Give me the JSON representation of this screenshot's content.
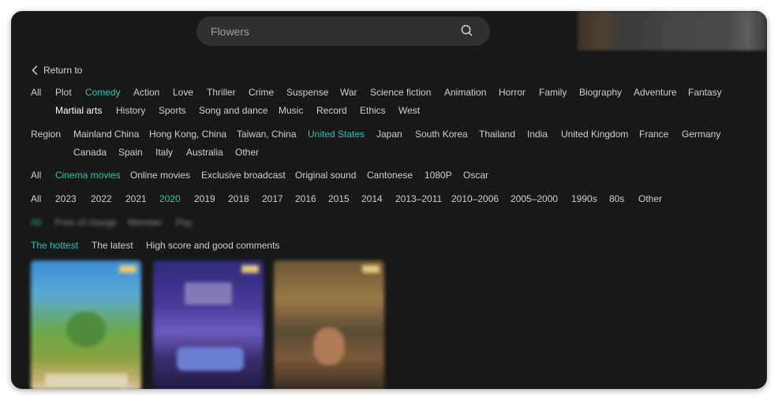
{
  "search": {
    "placeholder": "Flowers"
  },
  "nav": {
    "back_label": "Return to"
  },
  "genre": {
    "items": [
      "All",
      "Plot",
      "Comedy",
      "Action",
      "Love",
      "Thriller",
      "Crime",
      "Suspense",
      "War",
      "Science fiction",
      "Animation",
      "Horror",
      "Family",
      "Biography",
      "Adventure",
      "Fantasy",
      "Martial arts",
      "History",
      "Sports",
      "Song and dance",
      "Music",
      "Record",
      "Ethics",
      "West"
    ],
    "active": "Comedy"
  },
  "region": {
    "label": "Region",
    "items": [
      "Mainland China",
      "Hong Kong, China",
      "Taiwan, China",
      "United States",
      "Japan",
      "South Korea",
      "Thailand",
      "India",
      "United Kingdom",
      "France",
      "Germany",
      "Canada",
      "Spain",
      "Italy",
      "Australia",
      "Other"
    ],
    "active": "United States"
  },
  "feature": {
    "items": [
      "All",
      "Cinema movies",
      "Online movies",
      "Exclusive broadcast",
      "Original sound",
      "Cantonese",
      "1080P",
      "Oscar"
    ],
    "active": "Cinema movies"
  },
  "year": {
    "items": [
      "All",
      "2023",
      "2022",
      "2021",
      "2020",
      "2019",
      "2018",
      "2017",
      "2016",
      "2015",
      "2014",
      "2013–2011",
      "2010–2006",
      "2005–2000",
      "1990s",
      "80s",
      "Other"
    ],
    "active": "2020"
  },
  "payment": {
    "items": [
      "All",
      "Free of charge",
      "Member",
      "Pay"
    ],
    "active": "All"
  },
  "sort": {
    "items": [
      "The hottest",
      "The latest",
      "High score and good comments"
    ],
    "active": "The hottest"
  },
  "posters": [
    {
      "name": "poster-1"
    },
    {
      "name": "poster-2"
    },
    {
      "name": "poster-3"
    }
  ],
  "colors": {
    "accent": "#2fc3ba",
    "background": "#181818",
    "search_bg": "#303030"
  },
  "icons": {
    "search": "search-icon",
    "back": "chevron-left-icon"
  }
}
